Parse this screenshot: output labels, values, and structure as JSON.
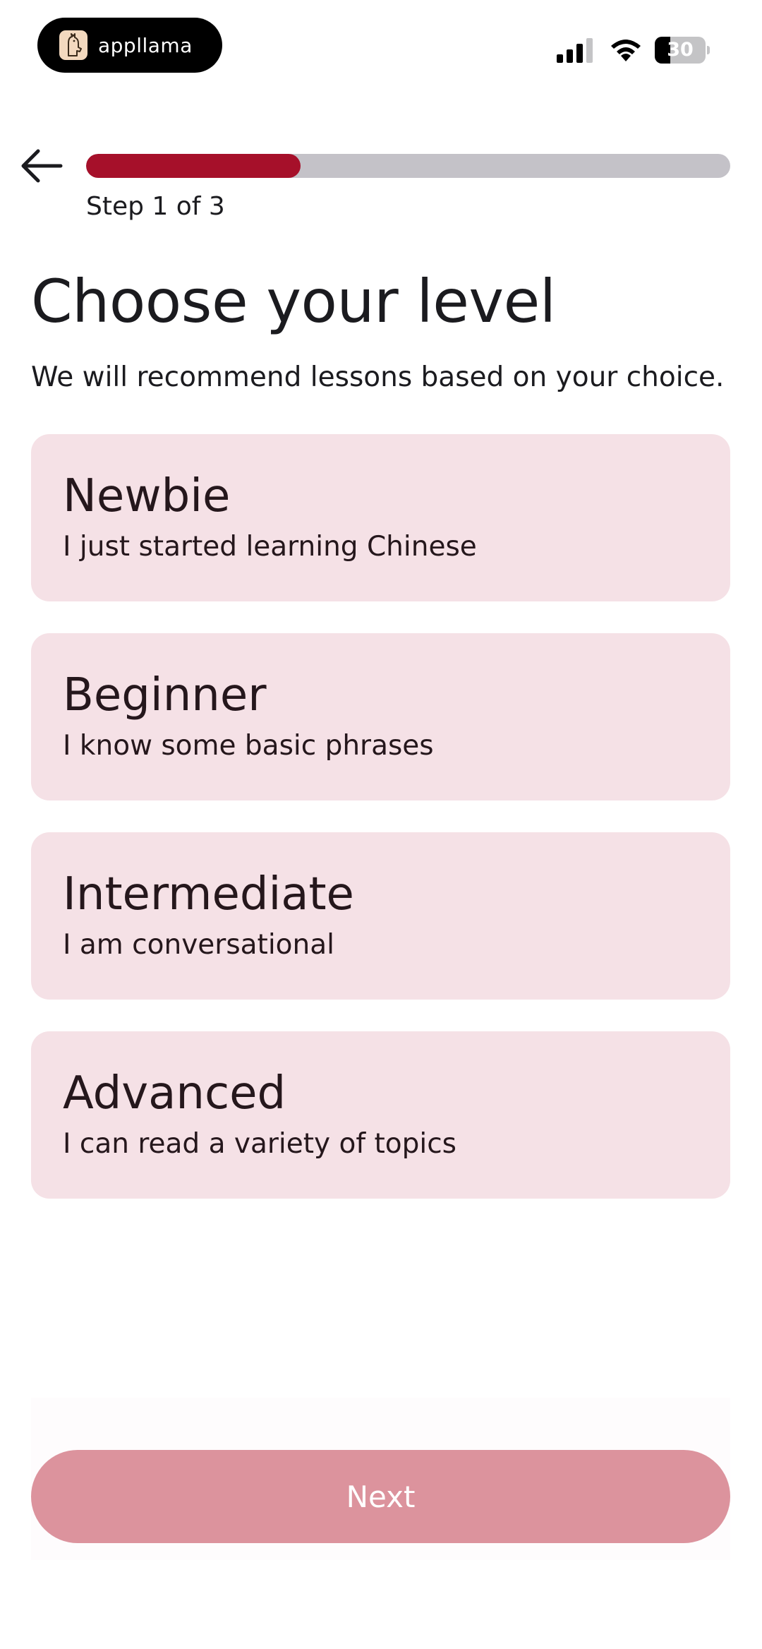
{
  "status_bar": {
    "app_name": "appllama",
    "battery_level": "30",
    "battery_fraction": 0.3
  },
  "header": {
    "progress_fraction": 0.333,
    "step_label": "Step 1 of 3"
  },
  "main": {
    "title": "Choose your level",
    "subtitle": "We will recommend lessons based on your choice.",
    "levels": [
      {
        "name": "Newbie",
        "description": "I just started learning Chinese"
      },
      {
        "name": "Beginner",
        "description": "I know some basic phrases"
      },
      {
        "name": "Intermediate",
        "description": "I am conversational"
      },
      {
        "name": "Advanced",
        "description": "I can read a variety of topics"
      }
    ]
  },
  "footer": {
    "next_label": "Next"
  },
  "colors": {
    "accent": "#a6102a",
    "card_background": "#f5e1e6",
    "button_disabled": "#dc939d"
  }
}
